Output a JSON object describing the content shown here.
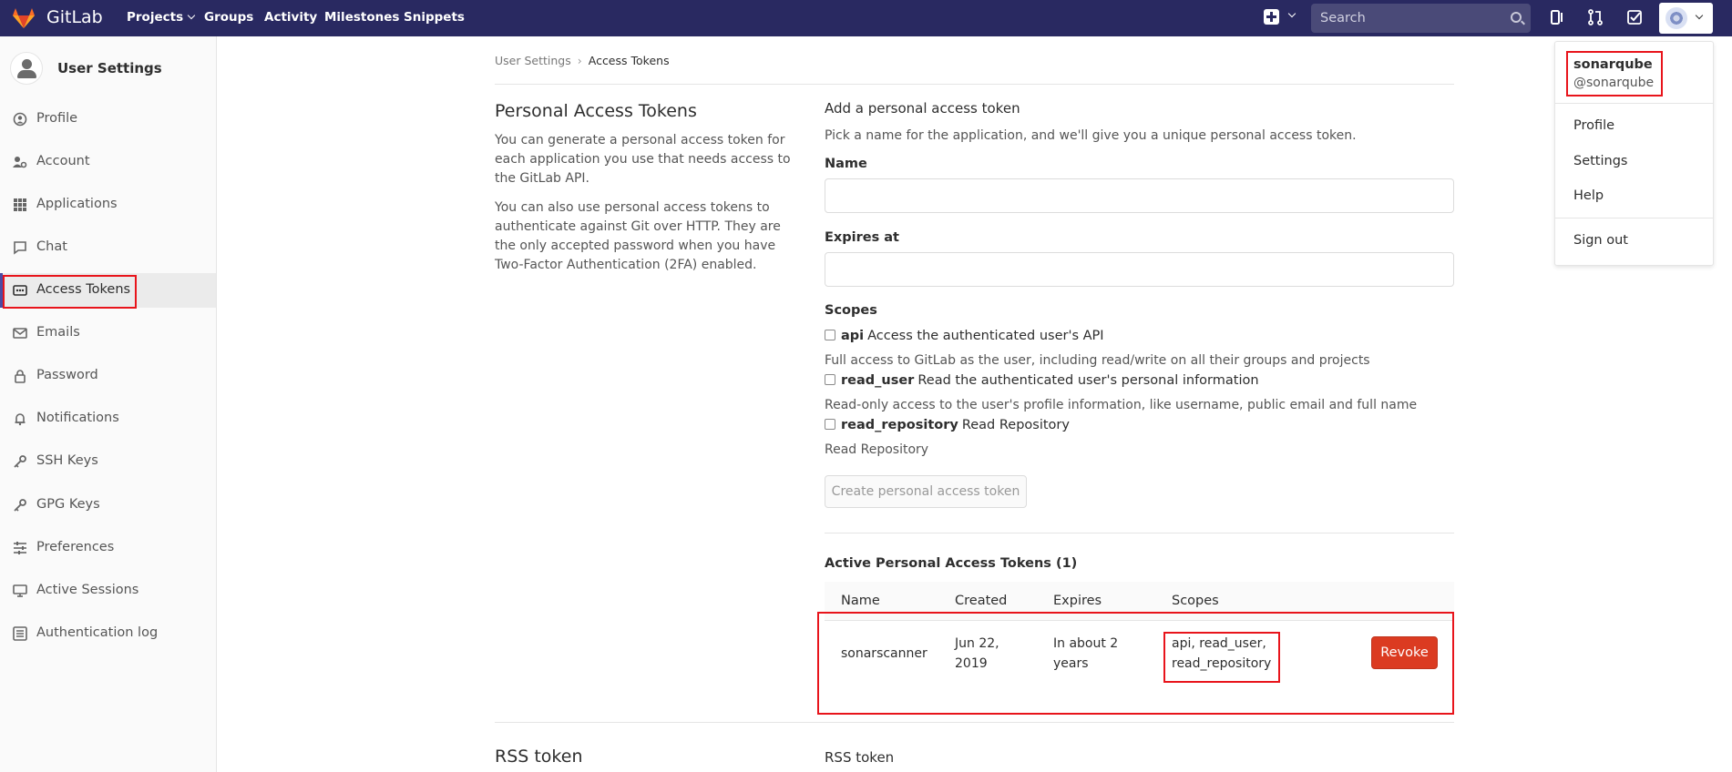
{
  "navbar": {
    "brand": "GitLab",
    "projects": "Projects",
    "groups": "Groups",
    "activity": "Activity",
    "milestones": "Milestones",
    "snippets": "Snippets",
    "search_placeholder": "Search"
  },
  "sidebar": {
    "title": "User Settings",
    "items": [
      {
        "label": "Profile",
        "icon": "profile-icon"
      },
      {
        "label": "Account",
        "icon": "account-icon"
      },
      {
        "label": "Applications",
        "icon": "applications-icon"
      },
      {
        "label": "Chat",
        "icon": "chat-icon"
      },
      {
        "label": "Access Tokens",
        "icon": "token-icon"
      },
      {
        "label": "Emails",
        "icon": "mail-icon"
      },
      {
        "label": "Password",
        "icon": "lock-icon"
      },
      {
        "label": "Notifications",
        "icon": "bell-icon"
      },
      {
        "label": "SSH Keys",
        "icon": "key-icon"
      },
      {
        "label": "GPG Keys",
        "icon": "key-icon"
      },
      {
        "label": "Preferences",
        "icon": "sliders-icon"
      },
      {
        "label": "Active Sessions",
        "icon": "monitor-icon"
      },
      {
        "label": "Authentication log",
        "icon": "list-icon"
      }
    ]
  },
  "breadcrumb": {
    "parent": "User Settings",
    "sep": "›",
    "current": "Access Tokens"
  },
  "pat": {
    "title": "Personal Access Tokens",
    "desc1": "You can generate a personal access token for each application you use that needs access to the GitLab API.",
    "desc2": "You can also use personal access tokens to authenticate against Git over HTTP. They are the only accepted password when you have Two-Factor Authentication (2FA) enabled."
  },
  "form": {
    "heading": "Add a personal access token",
    "subheading": "Pick a name for the application, and we'll give you a unique personal access token.",
    "name_label": "Name",
    "expires_label": "Expires at",
    "scopes_label": "Scopes",
    "scopes": [
      {
        "name": "api",
        "title": "Access the authenticated user's API",
        "desc": "Full access to GitLab as the user, including read/write on all their groups and projects"
      },
      {
        "name": "read_user",
        "title": "Read the authenticated user's personal information",
        "desc": "Read-only access to the user's profile information, like username, public email and full name"
      },
      {
        "name": "read_repository",
        "title": "Read Repository",
        "desc": "Read Repository"
      }
    ],
    "submit": "Create personal access token"
  },
  "active_tokens": {
    "title": "Active Personal Access Tokens (1)",
    "headers": [
      "Name",
      "Created",
      "Expires",
      "Scopes"
    ],
    "rows": [
      {
        "name": "sonarscanner",
        "created_l1": "Jun 22,",
        "created_l2": "2019",
        "expires_l1": "In about 2",
        "expires_l2": "years",
        "scopes_l1": "api, read_user,",
        "scopes_l2": "read_repository",
        "action": "Revoke"
      }
    ]
  },
  "rss": {
    "title": "RSS token",
    "right_title": "RSS token"
  },
  "user_menu": {
    "name": "sonarqube",
    "handle": "@sonarqube",
    "items": [
      "Profile",
      "Settings",
      "Help"
    ],
    "signout": "Sign out"
  },
  "colors": {
    "navbar": "#292961",
    "revoke": "#db3b21",
    "highlight": "#e8141b"
  }
}
